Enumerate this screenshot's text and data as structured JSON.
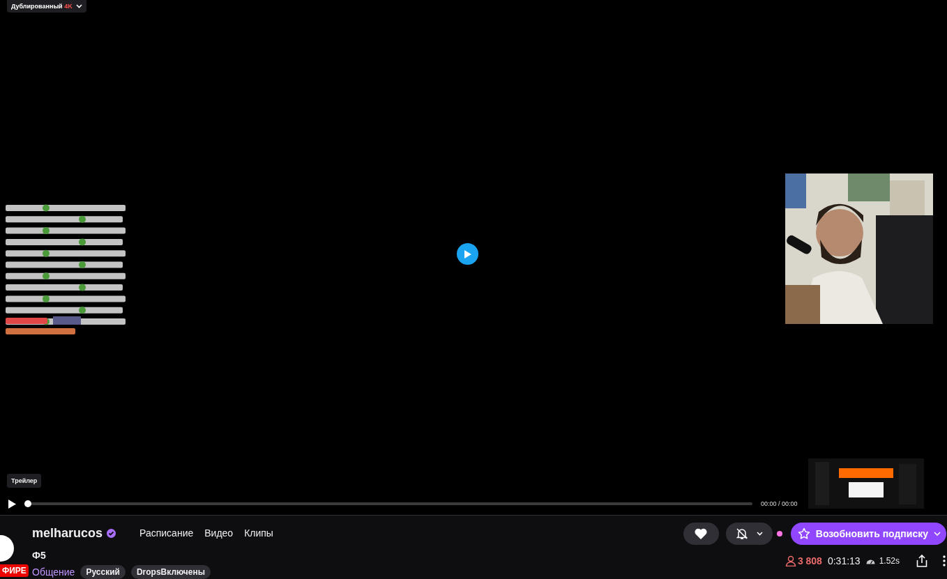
{
  "player": {
    "audio_track": {
      "label": "Дублированный",
      "badge": "4K"
    },
    "tooltip": "Трейлер",
    "time": "00:00 / 00:00",
    "progress": {
      "level": 0
    }
  },
  "channel": {
    "live_badge": "ФИРЕ",
    "name": "melharucos",
    "verified": true,
    "nav": [
      {
        "label": "Расписание"
      },
      {
        "label": "Видео"
      },
      {
        "label": "Клипы"
      }
    ],
    "title": "Ф5",
    "category": "Общение",
    "tags": [
      "Русский",
      "DropsВключены"
    ],
    "notifications_on": false,
    "subscribe_label": "Возобновить подписку",
    "viewers": "3 808",
    "uptime": "0:31:13",
    "latency": "1.52s"
  }
}
